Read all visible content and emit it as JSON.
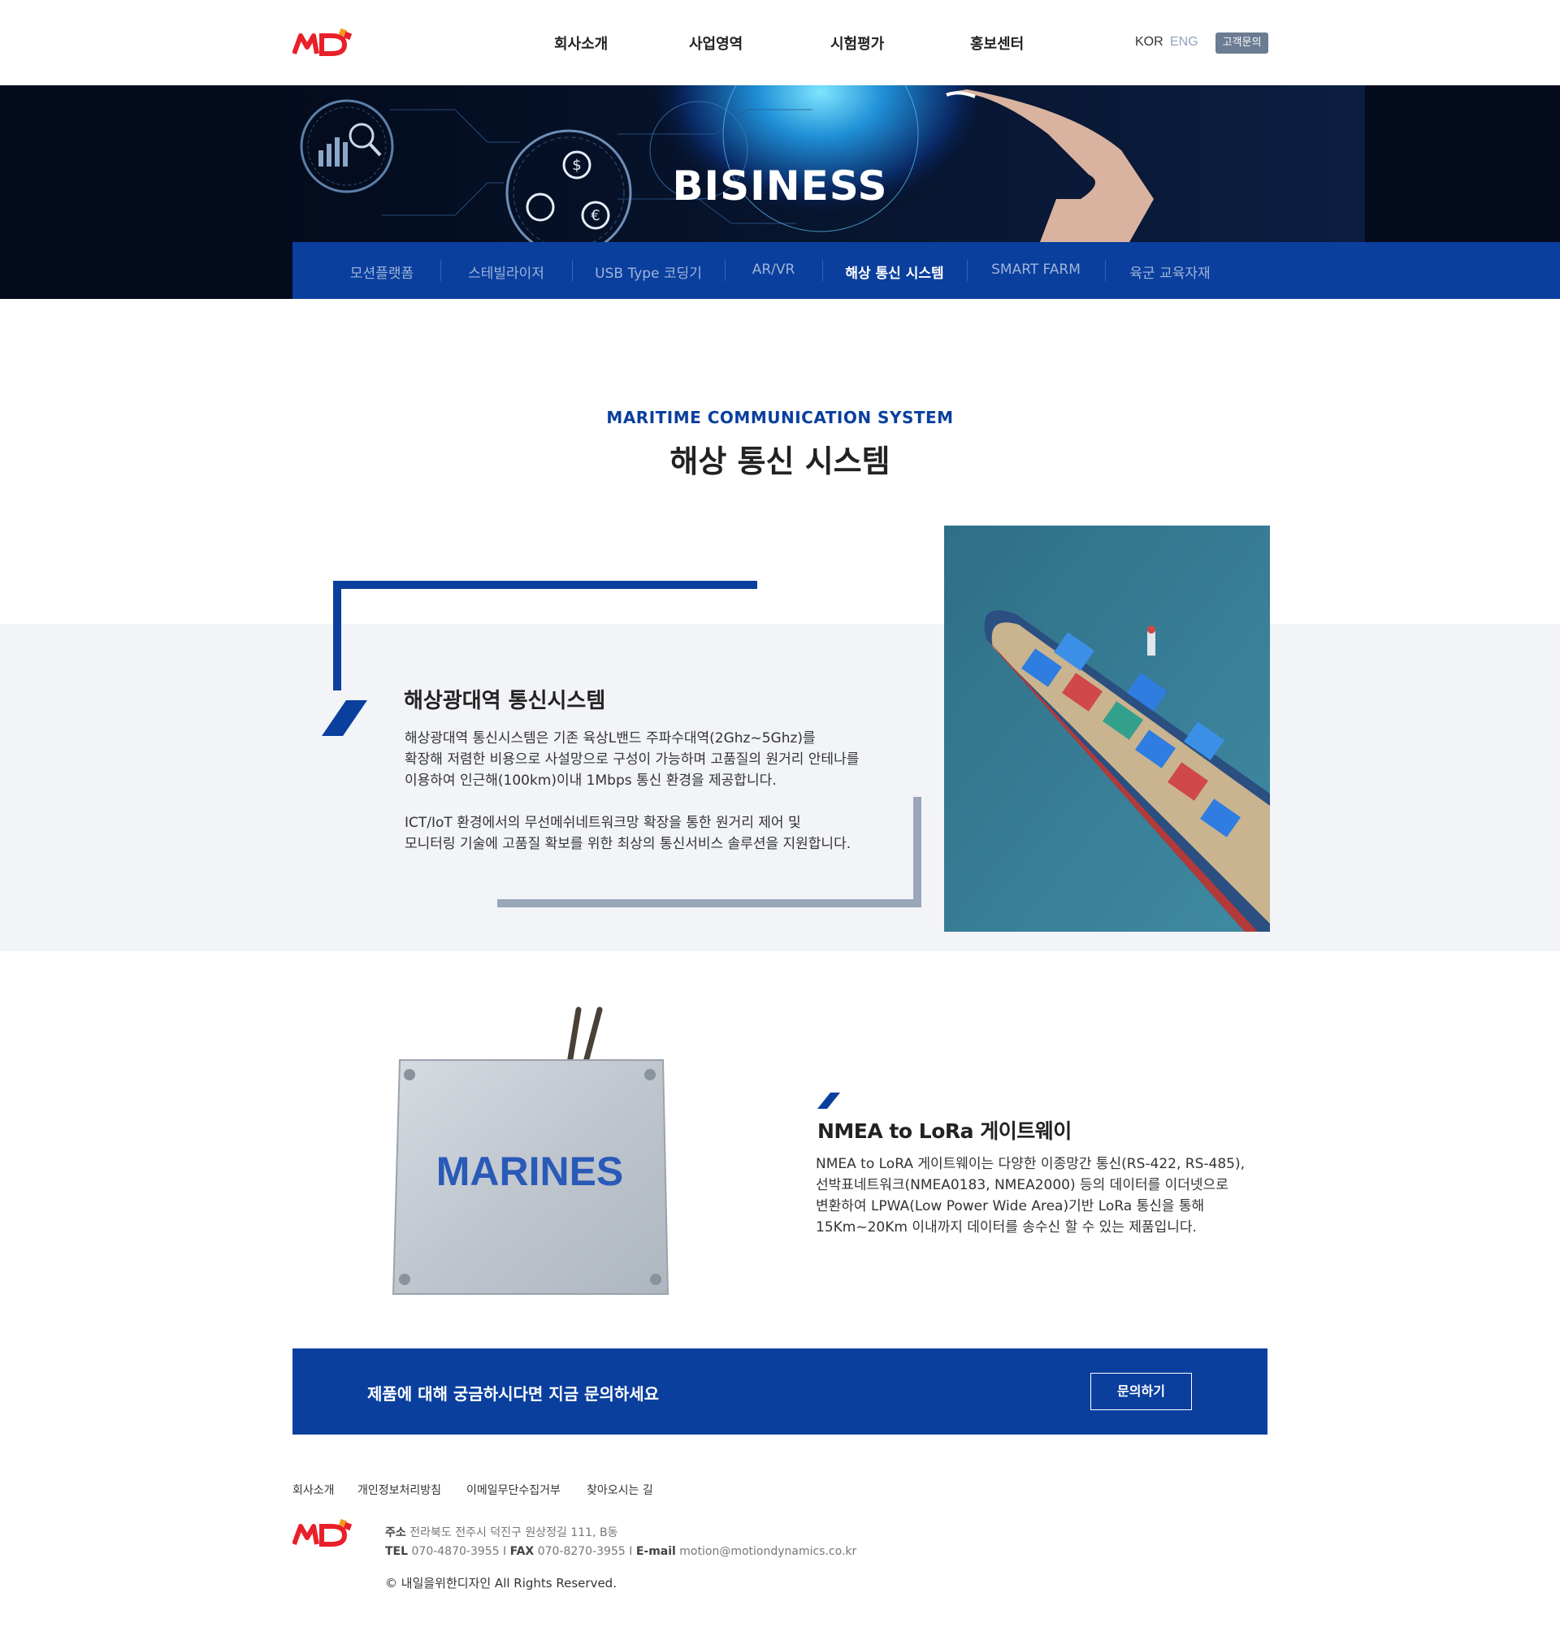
{
  "header": {
    "nav": [
      "회사소개",
      "사업영역",
      "시험평가",
      "홍보센터"
    ],
    "lang_kor": "KOR",
    "lang_eng": "ENG",
    "contact_label": "고객문의"
  },
  "banner": {
    "title": "BISINESS"
  },
  "subnav": {
    "items": [
      "모션플랫폼",
      "스테빌라이저",
      "USB Type 코딩기",
      "AR/VR",
      "해상 통신 시스템",
      "SMART FARM",
      "육군 교육자재"
    ],
    "active_index": 4
  },
  "section": {
    "title_en": "MARITIME COMMUNICATION SYSTEM",
    "title_ko": "해상 통신 시스템"
  },
  "feature1": {
    "title": "해상광대역 통신시스템",
    "lines": [
      "해상광대역 통신시스템은 기존 육상L밴드 주파수대역(2Ghz~5Ghz)를",
      "확장해 저렴한 비용으로 사설망으로 구성이 가능하며 고품질의 원거리 안테나를",
      "이용하여 인근해(100km)이내 1Mbps 통신 환경을 제공합니다.",
      " ICT/IoT 환경에서의 무선메쉬네트워크망 확장을 통한 원거리 제어 및",
      "모니터링 기술에 고품질 확보를 위한 최상의 통신서비스 솔루션을 지원합니다."
    ]
  },
  "feature2": {
    "device_label": "MARINES",
    "title": "NMEA to LoRa 게이트웨이",
    "lines": [
      "NMEA to LoRA 게이트웨이는 다양한 이종망간 통신(RS-422, RS-485),",
      " 선박표네트워크(NMEA0183, NMEA2000) 등의 데이터를 이더넷으로",
      "변환하여 LPWA(Low Power Wide Area)기반 LoRa 통신을 통해",
      "15Km~20Km 이내까지 데이터를 송수신 할 수 있는 제품입니다."
    ]
  },
  "cta": {
    "text": "제품에 대해 궁금하시다면 지금 문의하세요",
    "button": "문의하기"
  },
  "footer": {
    "links": [
      "회사소개",
      "개인정보처리방침",
      "이메일무단수집거부",
      "찾아오시는 길"
    ],
    "address_label": "주소",
    "address": "전라북도 전주시 덕진구 원상정길 111, B동",
    "tel_label": "TEL",
    "tel": "070-4870-3955",
    "fax_label": "FAX",
    "fax": "070-8270-3955",
    "email_label": "E-mail",
    "email": "motion@motiondynamics.co.kr",
    "copyright": "© 내일을위한디자인  All Rights Reserved."
  },
  "colors": {
    "brand_blue": "#0a3f9e",
    "logo_red": "#e8202a",
    "banner_dark": "#030b1c",
    "gray_bg": "#f2f4f8"
  },
  "icons": [
    "md-logo",
    "chart-magnifier-icon",
    "currency-cycle-icon"
  ]
}
